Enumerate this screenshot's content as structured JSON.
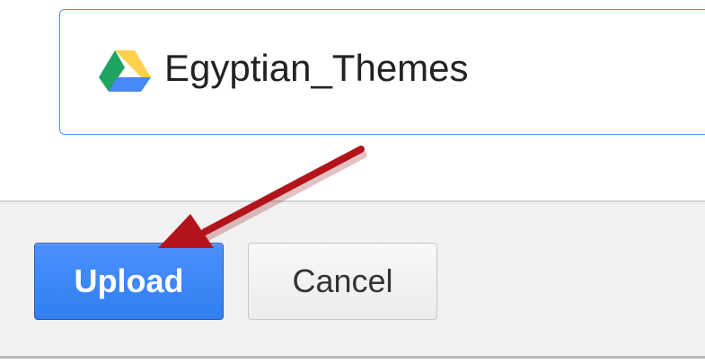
{
  "folder": {
    "name": "Egyptian_Themes",
    "icon": "google-drive-icon"
  },
  "footer": {
    "upload_label": "Upload",
    "cancel_label": "Cancel"
  },
  "annotation": {
    "icon": "red-arrow-icon",
    "color": "#b3141b"
  },
  "colors": {
    "accent": "#4d90fe",
    "upload_button": "#2f7ff0",
    "drive_green": "#1fa463",
    "drive_yellow": "#ffd04b",
    "drive_blue": "#4688f4"
  }
}
